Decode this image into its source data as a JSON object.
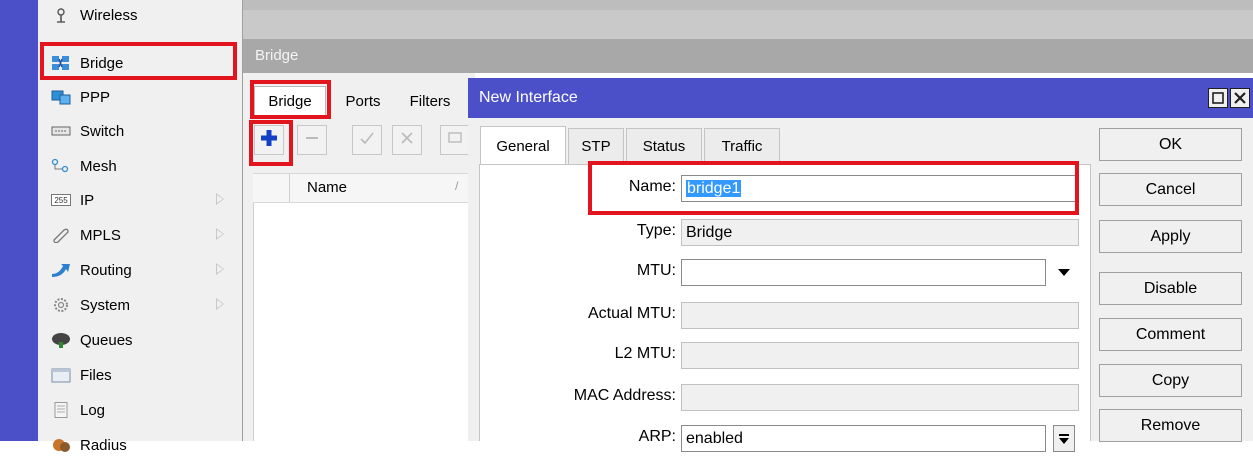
{
  "sidebar": {
    "items": [
      {
        "label": "Wireless",
        "icon": "wireless-icon",
        "has_submenu": false
      },
      {
        "label": "Bridge",
        "icon": "bridge-icon",
        "has_submenu": false
      },
      {
        "label": "PPP",
        "icon": "ppp-icon",
        "has_submenu": false
      },
      {
        "label": "Switch",
        "icon": "switch-icon",
        "has_submenu": false
      },
      {
        "label": "Mesh",
        "icon": "mesh-icon",
        "has_submenu": false
      },
      {
        "label": "IP",
        "icon": "ip-icon",
        "has_submenu": true
      },
      {
        "label": "MPLS",
        "icon": "mpls-icon",
        "has_submenu": true
      },
      {
        "label": "Routing",
        "icon": "routing-icon",
        "has_submenu": true
      },
      {
        "label": "System",
        "icon": "system-icon",
        "has_submenu": true
      },
      {
        "label": "Queues",
        "icon": "queues-icon",
        "has_submenu": false
      },
      {
        "label": "Files",
        "icon": "files-icon",
        "has_submenu": false
      },
      {
        "label": "Log",
        "icon": "log-icon",
        "has_submenu": false
      },
      {
        "label": "Radius",
        "icon": "radius-icon",
        "has_submenu": false
      }
    ],
    "ip_icon_text": "255"
  },
  "bridge_window": {
    "title": "Bridge",
    "tabs": [
      "Bridge",
      "Ports",
      "Filters"
    ],
    "list_header": {
      "name": "Name"
    }
  },
  "dialog": {
    "title": "New Interface",
    "tabs": [
      "General",
      "STP",
      "Status",
      "Traffic"
    ],
    "active_tab": "General",
    "fields": {
      "name": {
        "label": "Name:",
        "value": "bridge1"
      },
      "type": {
        "label": "Type:",
        "value": "Bridge"
      },
      "mtu": {
        "label": "MTU:",
        "value": ""
      },
      "actual_mtu": {
        "label": "Actual MTU:",
        "value": ""
      },
      "l2_mtu": {
        "label": "L2 MTU:",
        "value": ""
      },
      "mac_address": {
        "label": "MAC Address:",
        "value": ""
      },
      "arp": {
        "label": "ARP:",
        "value": "enabled"
      }
    },
    "buttons": {
      "ok": "OK",
      "cancel": "Cancel",
      "apply": "Apply",
      "disable": "Disable",
      "comment": "Comment",
      "copy": "Copy",
      "remove": "Remove"
    }
  },
  "colors": {
    "accent": "#4c50c8",
    "highlight": "#e2141e",
    "selection": "#3399ff"
  }
}
